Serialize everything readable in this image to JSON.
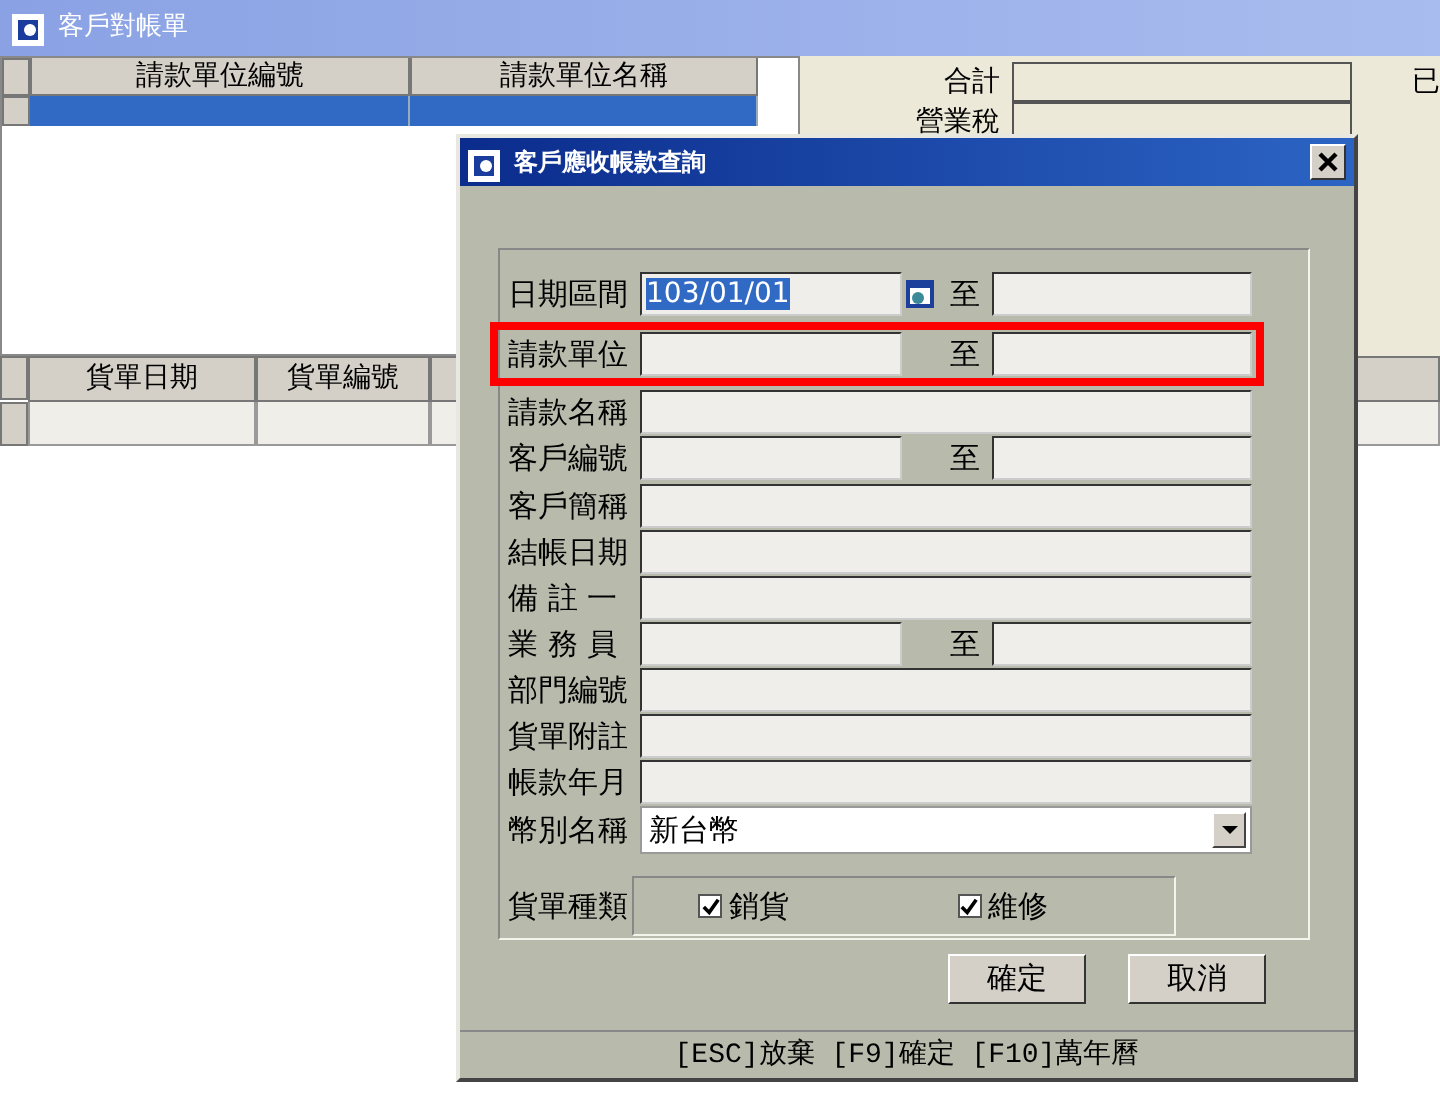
{
  "window": {
    "title": "客戶對帳單"
  },
  "master_grid": {
    "columns": [
      "請款單位編號",
      "請款單位名稱"
    ],
    "rows": [
      {
        "selected": true
      }
    ]
  },
  "totals": [
    {
      "label": "合計"
    },
    {
      "label": "營業稅"
    }
  ],
  "right_edge_label": "已",
  "detail_grid": {
    "columns": [
      "貨單日期",
      "貨單編號"
    ]
  },
  "dialog": {
    "title": "客戶應收帳款查詢",
    "fields": [
      {
        "label": "日期區間",
        "kind": "range",
        "from": "103/01/01",
        "from_selected": true,
        "calendar_icon": true,
        "to_label": "至",
        "highlighted": false
      },
      {
        "label": "請款單位",
        "kind": "range",
        "to_label": "至",
        "highlighted": true
      },
      {
        "label": "請款名稱",
        "kind": "text",
        "highlighted": false
      },
      {
        "label": "客戶編號",
        "kind": "range",
        "to_label": "至",
        "highlighted": false
      },
      {
        "label": "客戶簡稱",
        "kind": "text",
        "highlighted": false
      },
      {
        "label": "結帳日期",
        "kind": "text",
        "highlighted": false
      },
      {
        "label": "備 註 一",
        "kind": "text",
        "highlighted": false
      },
      {
        "label": "業 務 員",
        "kind": "range",
        "to_label": "至",
        "highlighted": false
      },
      {
        "label": "部門編號",
        "kind": "text",
        "highlighted": false
      },
      {
        "label": "貨單附註",
        "kind": "text",
        "highlighted": false
      },
      {
        "label": "帳款年月",
        "kind": "text",
        "highlighted": false
      },
      {
        "label": "幣別名稱",
        "kind": "select",
        "value": "新台幣",
        "highlighted": false
      }
    ],
    "doc_types": {
      "label": "貨單種類",
      "options": [
        {
          "label": "銷貨",
          "checked": true
        },
        {
          "label": "維修",
          "checked": true
        }
      ]
    },
    "buttons": [
      "確定",
      "取消"
    ],
    "status_text": "[ESC]放棄 [F9]確定 [F10]萬年曆"
  },
  "annotation": {
    "kind": "box",
    "color": "#ff0000"
  }
}
